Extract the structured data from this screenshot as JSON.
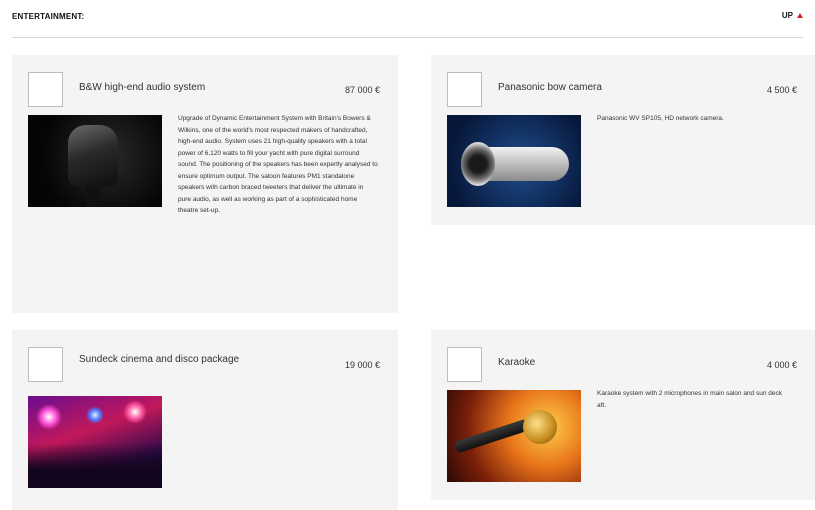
{
  "header": {
    "title": "ENTERTAINMENT:",
    "up_label": "UP"
  },
  "items": [
    {
      "name": "B&W high-end audio system",
      "price": "87 000 €",
      "image": "speaker",
      "description": "Upgrade of Dynamic Entertainment System with Britain's Bowers & Wilkins, one of the world's most respected makers of handcrafted, high-end audio. System uses 21 high-quality speakers with a total power of 6,120 watts to fill your yacht with pure digital surround sound. The positioning of the speakers has been expertly analysed to ensure optimum output. The saloon features PM1 standalone speakers with carbon braced tweeters that deliver the ultimate in pure audio, as well as working as part of a sophisticated home theatre set-up."
    },
    {
      "name": "Panasonic bow camera",
      "price": "4 500 €",
      "image": "camera",
      "description": "Panasonic WV SP105, HD network camera."
    },
    {
      "name": "Sundeck cinema and disco package",
      "price": "19 000 €",
      "image": "disco",
      "description": ""
    },
    {
      "name": "Karaoke",
      "price": "4 000 €",
      "image": "microphone",
      "description": "Karaoke system with 2 microphones in main salon and sun deck aft."
    }
  ],
  "colors": {
    "accent": "#d5232c",
    "card_bg": "#f4f4f4"
  }
}
